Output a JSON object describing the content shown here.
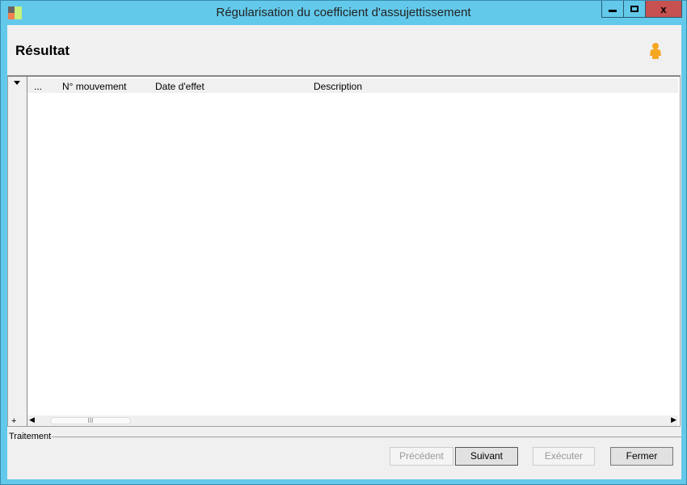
{
  "window": {
    "title": "Régularisation du coefficient d'assujettissement",
    "minimize": "▁",
    "maximize": "▢",
    "close": "x"
  },
  "header": {
    "title": "Résultat",
    "icon": "user-icon"
  },
  "grid": {
    "columns": [
      "...",
      "N° mouvement",
      "Date d'effet",
      "Description"
    ],
    "rows": [],
    "add_symbol": "+",
    "scroll_thumb": "III"
  },
  "footer": {
    "group_label": "Traitement",
    "buttons": {
      "previous": "Précédent",
      "next": "Suivant",
      "execute": "Exécuter",
      "close": "Fermer"
    }
  },
  "colors": {
    "frame": "#63c9ea",
    "close": "#c75050"
  }
}
